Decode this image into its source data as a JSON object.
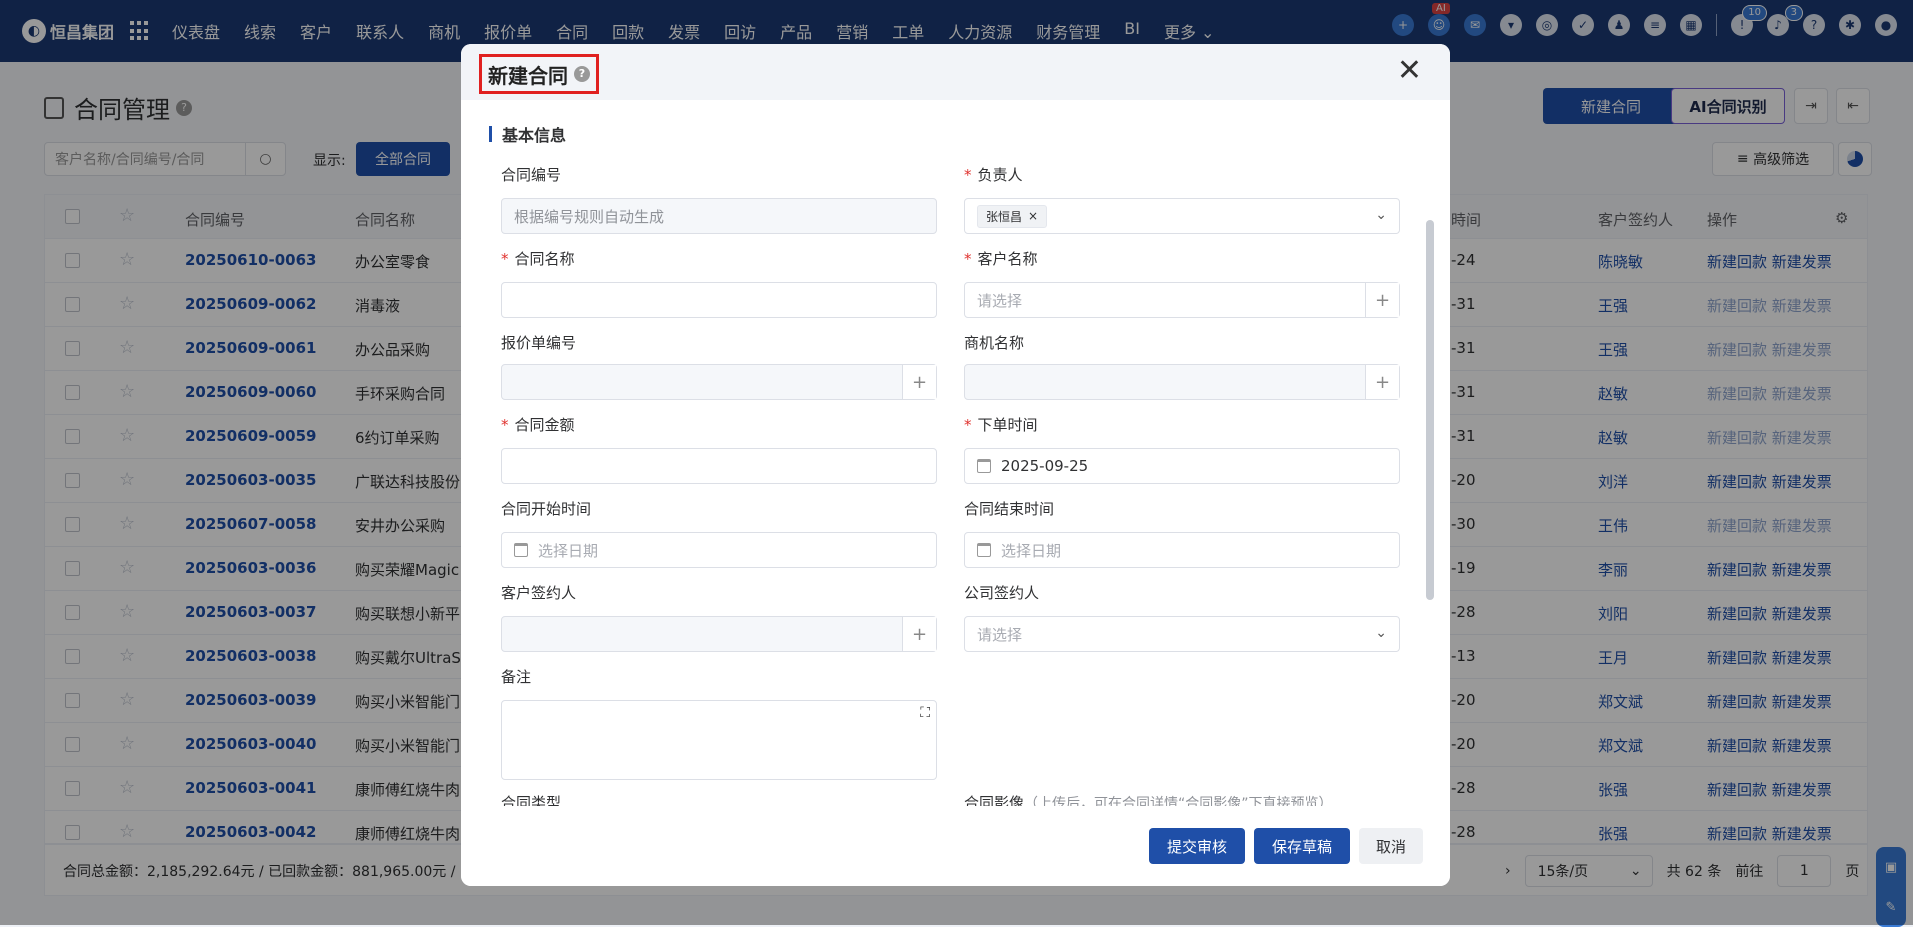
{
  "topbar": {
    "brand": "恒昌集团",
    "nav": [
      "仪表盘",
      "线索",
      "客户",
      "联系人",
      "商机",
      "报价单",
      "合同",
      "回款",
      "发票",
      "回访",
      "产品",
      "营销",
      "工单",
      "人力资源",
      "财务管理",
      "BI",
      "更多 ⌄"
    ],
    "ai_badge": "AI",
    "badge_a": "10",
    "badge_b": "3"
  },
  "page": {
    "title": "合同管理",
    "new_contract": "新建合同",
    "ai_recognize": "AI合同识别",
    "search_placeholder": "客户名称/合同编号/合同",
    "show_label": "显示:",
    "all_contracts": "全部合同",
    "advanced_filter": "高级筛选"
  },
  "table": {
    "headers": {
      "no": "合同编号",
      "name": "合同名称",
      "time": "時间",
      "signer": "客户签约人",
      "op": "操作"
    },
    "rows": [
      {
        "no": "20250610-0063",
        "name": "办公室零食",
        "time": "-24",
        "signer": "陈晓敏",
        "op": "新建回款  新建发票",
        "dim": false
      },
      {
        "no": "20250609-0062",
        "name": "消毒液",
        "time": "-31",
        "signer": "王强",
        "op": "新建回款  新建发票",
        "dim": true
      },
      {
        "no": "20250609-0061",
        "name": "办公品采购",
        "time": "-31",
        "signer": "王强",
        "op": "新建回款  新建发票",
        "dim": true
      },
      {
        "no": "20250609-0060",
        "name": "手环采购合同",
        "time": "-31",
        "signer": "赵敏",
        "op": "新建回款  新建发票",
        "dim": true
      },
      {
        "no": "20250609-0059",
        "name": "6约订单采购",
        "time": "-31",
        "signer": "赵敏",
        "op": "新建回款  新建发票",
        "dim": true
      },
      {
        "no": "20250603-0035",
        "name": "广联达科技股份",
        "time": "-20",
        "signer": "刘洋",
        "op": "新建回款  新建发票",
        "dim": false
      },
      {
        "no": "20250607-0058",
        "name": "安井办公采购",
        "time": "-30",
        "signer": "王伟",
        "op": "新建回款  新建发票",
        "dim": true
      },
      {
        "no": "20250603-0036",
        "name": "购买荣耀Magic",
        "time": "-19",
        "signer": "李丽",
        "op": "新建回款  新建发票",
        "dim": false
      },
      {
        "no": "20250603-0037",
        "name": "购买联想小新平",
        "time": "-28",
        "signer": "刘阳",
        "op": "新建回款  新建发票",
        "dim": false
      },
      {
        "no": "20250603-0038",
        "name": "购买戴尔UltraSt",
        "time": "-13",
        "signer": "王月",
        "op": "新建回款  新建发票",
        "dim": false
      },
      {
        "no": "20250603-0039",
        "name": "购买小米智能门",
        "time": "-20",
        "signer": "郑文斌",
        "op": "新建回款  新建发票",
        "dim": false
      },
      {
        "no": "20250603-0040",
        "name": "购买小米智能门",
        "time": "-20",
        "signer": "郑文斌",
        "op": "新建回款  新建发票",
        "dim": false
      },
      {
        "no": "20250603-0041",
        "name": "康师傅红烧牛肉",
        "time": "-28",
        "signer": "张强",
        "op": "新建回款  新建发票",
        "dim": false
      },
      {
        "no": "20250603-0042",
        "name": "康师傅红烧牛肉",
        "time": "-28",
        "signer": "张强",
        "op": "新建回款  新建发票",
        "dim": false
      }
    ]
  },
  "footer": {
    "totals": "合同总金额：2,185,292.64元 / 已回款金额：881,965.00元 /",
    "page_size": "15条/页",
    "total_count": "共 62 条",
    "goto": "前往",
    "page_no": "1",
    "page_unit": "页"
  },
  "dialog": {
    "title": "新建合同",
    "section": "基本信息",
    "fields": {
      "contract_no_label": "合同编号",
      "contract_no_placeholder": "根据编号规则自动生成",
      "owner_label": "负责人",
      "owner_tag": "张恒昌",
      "name_label": "合同名称",
      "customer_label": "客户名称",
      "customer_placeholder": "请选择",
      "quote_label": "报价单编号",
      "opportunity_label": "商机名称",
      "amount_label": "合同金额",
      "order_time_label": "下单时间",
      "order_time_value": "2025-09-25",
      "start_label": "合同开始时间",
      "start_placeholder": "选择日期",
      "end_label": "合同结束时间",
      "end_placeholder": "选择日期",
      "cust_signer_label": "客户签约人",
      "company_signer_label": "公司签约人",
      "company_signer_placeholder": "请选择",
      "remark_label": "备注",
      "type_label": "合同类型",
      "image_label": "合同影像",
      "image_hint": "（上传后，可在合同详情“合同影像”下直接预览）"
    },
    "buttons": {
      "submit": "提交审核",
      "save": "保存草稿",
      "cancel": "取消"
    }
  }
}
